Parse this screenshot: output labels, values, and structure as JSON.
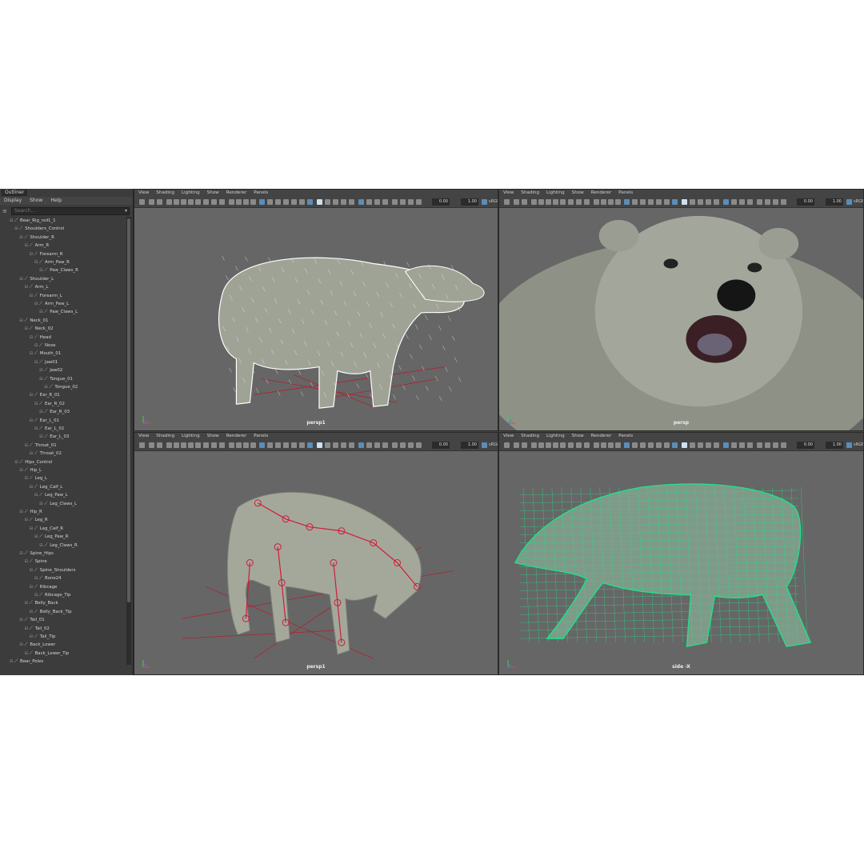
{
  "outliner": {
    "tab": "Outliner",
    "menu": [
      "Display",
      "Show",
      "Help"
    ],
    "search_placeholder": "Search...",
    "items": [
      {
        "label": "Bear_Rig_rsd1_1",
        "depth": 0
      },
      {
        "label": "Shoulders_Control",
        "depth": 1
      },
      {
        "label": "Shoulder_R",
        "depth": 2
      },
      {
        "label": "Arm_R",
        "depth": 3
      },
      {
        "label": "Forearm_R",
        "depth": 4
      },
      {
        "label": "Arm_Paw_R",
        "depth": 5
      },
      {
        "label": "Paw_Claws_R",
        "depth": 6
      },
      {
        "label": "Shoulder_L",
        "depth": 2
      },
      {
        "label": "Arm_L",
        "depth": 3
      },
      {
        "label": "Forearm_L",
        "depth": 4
      },
      {
        "label": "Arm_Paw_L",
        "depth": 5
      },
      {
        "label": "Paw_Claws_L",
        "depth": 6
      },
      {
        "label": "Neck_01",
        "depth": 2
      },
      {
        "label": "Neck_02",
        "depth": 3
      },
      {
        "label": "Head",
        "depth": 4
      },
      {
        "label": "Nose",
        "depth": 5
      },
      {
        "label": "Mouth_01",
        "depth": 4
      },
      {
        "label": "Jaw01",
        "depth": 5
      },
      {
        "label": "Jaw02",
        "depth": 6
      },
      {
        "label": "Tongue_01",
        "depth": 6
      },
      {
        "label": "Tongue_02",
        "depth": 7
      },
      {
        "label": "Ear_R_01",
        "depth": 4
      },
      {
        "label": "Ear_R_02",
        "depth": 5
      },
      {
        "label": "Ear_R_03",
        "depth": 6
      },
      {
        "label": "Ear_L_01",
        "depth": 4
      },
      {
        "label": "Ear_L_02",
        "depth": 5
      },
      {
        "label": "Ear_L_03",
        "depth": 6
      },
      {
        "label": "Throat_01",
        "depth": 3
      },
      {
        "label": "Throat_02",
        "depth": 4
      },
      {
        "label": "Hips_Control",
        "depth": 1
      },
      {
        "label": "Hip_L",
        "depth": 2
      },
      {
        "label": "Leg_L",
        "depth": 3
      },
      {
        "label": "Leg_Calf_L",
        "depth": 4
      },
      {
        "label": "Leg_Paw_L",
        "depth": 5
      },
      {
        "label": "Leg_Claws_L",
        "depth": 6
      },
      {
        "label": "Hip_R",
        "depth": 2
      },
      {
        "label": "Leg_R",
        "depth": 3
      },
      {
        "label": "Leg_Calf_R",
        "depth": 4
      },
      {
        "label": "Leg_Paw_R",
        "depth": 5
      },
      {
        "label": "Leg_Claws_R",
        "depth": 6
      },
      {
        "label": "Spine_Hips",
        "depth": 2
      },
      {
        "label": "Spine",
        "depth": 3
      },
      {
        "label": "Spine_Shoulders",
        "depth": 4
      },
      {
        "label": "Bone24",
        "depth": 5
      },
      {
        "label": "Ribcage",
        "depth": 4
      },
      {
        "label": "Ribcage_Tip",
        "depth": 5
      },
      {
        "label": "Belly_Back",
        "depth": 3
      },
      {
        "label": "Belly_Back_Tip",
        "depth": 4
      },
      {
        "label": "Tail_01",
        "depth": 2
      },
      {
        "label": "Tail_02",
        "depth": 3
      },
      {
        "label": "Tail_Tip",
        "depth": 4
      },
      {
        "label": "Back_Lower",
        "depth": 2
      },
      {
        "label": "Back_Lower_Tip",
        "depth": 3
      },
      {
        "label": "Bear_Poles",
        "depth": 0
      }
    ]
  },
  "viewport_menu": [
    "View",
    "Shading",
    "Lighting",
    "Show",
    "Renderer",
    "Panels"
  ],
  "toolbar_values": {
    "exposure": "0.00",
    "gamma": "1.00",
    "colorspace": "sRGB"
  },
  "viewports": [
    {
      "camera": "persp1",
      "mode": "fur"
    },
    {
      "camera": "persp",
      "mode": "closeup"
    },
    {
      "camera": "persp1",
      "mode": "skeleton"
    },
    {
      "camera": "side -X",
      "mode": "wireframe"
    }
  ],
  "colors": {
    "viewport_bg": "#666666",
    "bear_fur": "#9fa396",
    "joint_red": "#d01a3a",
    "wire_green": "#22e08a"
  }
}
